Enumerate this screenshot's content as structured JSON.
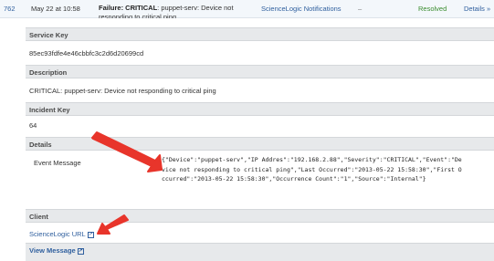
{
  "incident_row": {
    "id": "762",
    "created": "May 22 at 10:58",
    "summary_bold": "Failure: CRITICAL",
    "summary_rest": ": puppet-serv: Device not responding to critical ping",
    "service": "ScienceLogic Notifications",
    "assigned": "–",
    "status": "Resolved",
    "details_link": "Details »"
  },
  "sections": {
    "service_key": {
      "label": "Service Key",
      "value": "85ec93fdfe4e46cbbfc3c2d6d20699cd"
    },
    "description": {
      "label": "Description",
      "value": "CRITICAL: puppet-serv: Device not responding to critical ping"
    },
    "incident_key": {
      "label": "Incident Key",
      "value": "64"
    },
    "details": {
      "label": "Details",
      "event_label": "Event Message",
      "event_json": "{\"Device\":\"puppet-serv\",\"IP Addres\":\"192.168.2.88\",\"Severity\":\"CRITICAL\",\"Event\":\"Device not responding to critical ping\",\"Last Occurred\":\"2013-05-22 15:58:30\",\"First Occurred\":\"2013-05-22 15:58:30\",\"Occurrence Count\":\"1\",\"Source\":\"Internal\"}"
    },
    "client": {
      "label": "Client",
      "link": "ScienceLogic URL"
    }
  },
  "footer": {
    "view_message": "View Message"
  },
  "colors": {
    "link": "#2f5f9e",
    "resolved": "#3a8d2f",
    "section_bg": "#e7e9eb",
    "arrow": "#e8352b"
  },
  "icons": {
    "external_link": "external-link-icon",
    "annotation_arrow": "red-arrow"
  }
}
